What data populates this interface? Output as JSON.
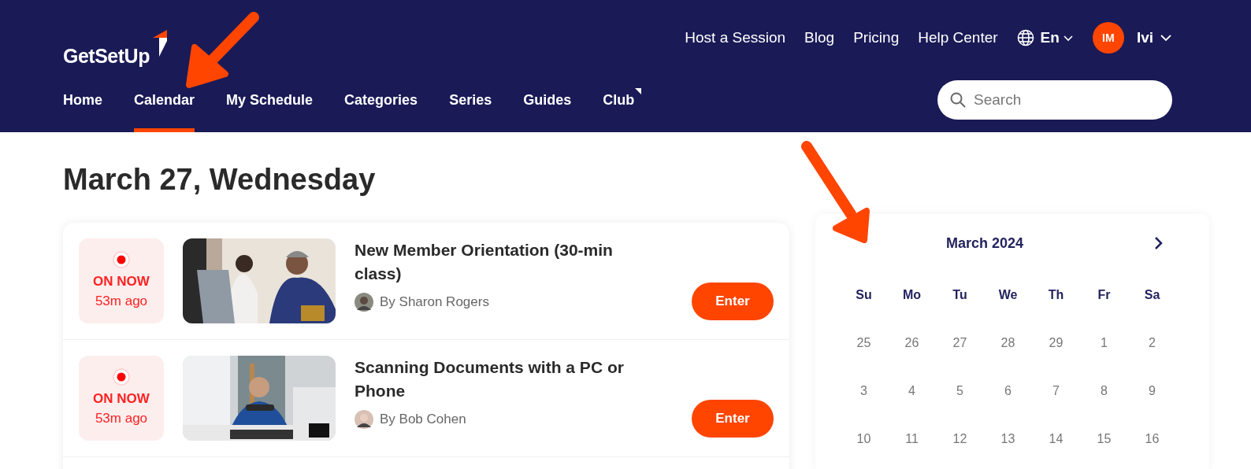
{
  "header": {
    "logo": "GetSetUp",
    "top_links": [
      "Host a Session",
      "Blog",
      "Pricing",
      "Help Center"
    ],
    "language": "En",
    "avatar_initials": "IM",
    "user_name": "Ivi",
    "nav": [
      {
        "label": "Home",
        "selected": false,
        "corner_mark": false
      },
      {
        "label": "Calendar",
        "selected": true,
        "corner_mark": false
      },
      {
        "label": "My Schedule",
        "selected": false,
        "corner_mark": false
      },
      {
        "label": "Categories",
        "selected": false,
        "corner_mark": false
      },
      {
        "label": "Series",
        "selected": false,
        "corner_mark": false
      },
      {
        "label": "Guides",
        "selected": false,
        "corner_mark": false
      },
      {
        "label": "Club",
        "selected": false,
        "corner_mark": true
      }
    ],
    "search": {
      "placeholder": "Search"
    }
  },
  "date_heading": "March 27, Wednesday",
  "sessions": [
    {
      "status": "ON NOW",
      "time_ago": "53m ago",
      "title": "New Member Orientation (30-min class)",
      "author": "By Sharon Rogers",
      "button": "Enter"
    },
    {
      "status": "ON NOW",
      "time_ago": "53m ago",
      "title": "Scanning Documents with a PC or Phone",
      "author": "By Bob Cohen",
      "button": "Enter"
    }
  ],
  "calendar": {
    "month": "March 2024",
    "weekdays": [
      "Su",
      "Mo",
      "Tu",
      "We",
      "Th",
      "Fr",
      "Sa"
    ],
    "weeks": [
      [
        "25",
        "26",
        "27",
        "28",
        "29",
        "1",
        "2"
      ],
      [
        "3",
        "4",
        "5",
        "6",
        "7",
        "8",
        "9"
      ],
      [
        "10",
        "11",
        "12",
        "13",
        "14",
        "15",
        "16"
      ]
    ]
  }
}
